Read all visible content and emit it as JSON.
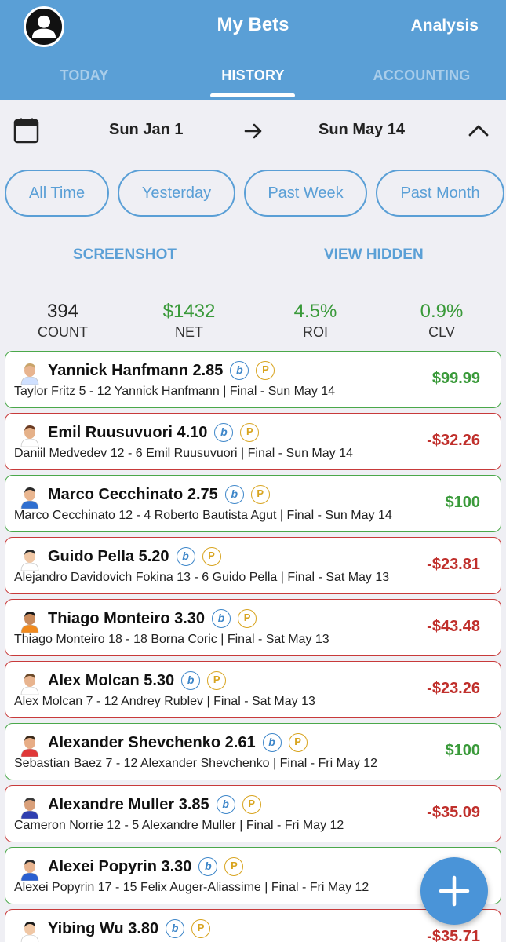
{
  "header": {
    "title": "My Bets",
    "analysis": "Analysis",
    "tabs": [
      "TODAY",
      "HISTORY",
      "ACCOUNTING"
    ],
    "active_tab": "HISTORY",
    "color": "#5a9fd6"
  },
  "date_range": {
    "from": "Sun Jan 1",
    "to": "Sun May 14"
  },
  "filters": [
    "All Time",
    "Yesterday",
    "Past Week",
    "Past Month"
  ],
  "links": {
    "screenshot": "SCREENSHOT",
    "view_hidden": "VIEW HIDDEN"
  },
  "stats": [
    {
      "value": "394",
      "label": "COUNT",
      "color": "#222222"
    },
    {
      "value": "$1432",
      "label": "NET",
      "color": "#3a9a3a"
    },
    {
      "value": "4.5%",
      "label": "ROI",
      "color": "#3a9a3a"
    },
    {
      "value": "0.9%",
      "label": "CLV",
      "color": "#3a9a3a"
    }
  ],
  "badges": {
    "b": "b",
    "p": "P"
  },
  "bets": [
    {
      "title": "Yannick Hanfmann 2.85",
      "subtitle": "Taylor Fritz 5 - 12 Yannick Hanfmann | Final  - Sun May 14",
      "amount": "$99.99",
      "result": "win"
    },
    {
      "title": "Emil Ruusuvuori 4.10",
      "subtitle": "Daniil Medvedev 12 - 6 Emil Ruusuvuori | Final  - Sun May 14",
      "amount": "-$32.26",
      "result": "loss"
    },
    {
      "title": "Marco Cecchinato 2.75",
      "subtitle": "Marco Cecchinato 12 - 4 Roberto Bautista Agut | Final  - Sun May 14",
      "amount": "$100",
      "result": "win"
    },
    {
      "title": "Guido Pella 5.20",
      "subtitle": "Alejandro Davidovich Fokina 13 - 6 Guido Pella | Final  - Sat May 13",
      "amount": "-$23.81",
      "result": "loss"
    },
    {
      "title": "Thiago Monteiro 3.30",
      "subtitle": "Thiago Monteiro 18 - 18 Borna Coric | Final  - Sat May 13",
      "amount": "-$43.48",
      "result": "loss"
    },
    {
      "title": "Alex Molcan 5.30",
      "subtitle": "Alex Molcan 7 - 12 Andrey Rublev | Final  - Sat May 13",
      "amount": "-$23.26",
      "result": "loss"
    },
    {
      "title": "Alexander Shevchenko 2.61",
      "subtitle": "Sebastian Baez 7 - 12 Alexander Shevchenko | Final  - Fri May 12",
      "amount": "$100",
      "result": "win"
    },
    {
      "title": "Alexandre Muller 3.85",
      "subtitle": "Cameron Norrie 12 - 5 Alexandre Muller | Final  - Fri May 12",
      "amount": "-$35.09",
      "result": "loss"
    },
    {
      "title": "Alexei Popyrin 3.30",
      "subtitle": "Alexei Popyrin 17 - 15 Felix Auger-Aliassime | Final  - Fri May 12",
      "amount": "",
      "result": "win"
    },
    {
      "title": "Yibing Wu 3.80",
      "subtitle": "",
      "amount": "-$35.71",
      "result": "loss"
    }
  ]
}
